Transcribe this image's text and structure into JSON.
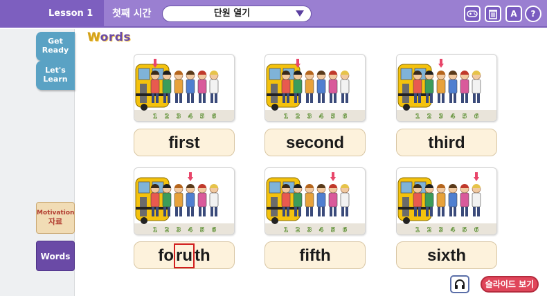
{
  "header": {
    "lesson_label": "Lesson 1",
    "session_title": "첫째 시간",
    "unit_select_value": "단원 열기",
    "tools": [
      {
        "icon": "gamepad-icon"
      },
      {
        "icon": "trash-icon"
      },
      {
        "icon": "dictionary-icon",
        "label": "A"
      },
      {
        "icon": "help-icon",
        "label": "?"
      }
    ]
  },
  "sidebar": {
    "get_ready": [
      "Get",
      "Ready"
    ],
    "lets_learn": [
      "Let's",
      "Learn"
    ],
    "motivation": [
      "Motivation",
      "자료"
    ],
    "words": "Words"
  },
  "main": {
    "heading_first": "W",
    "heading_rest": "ords",
    "cards": [
      {
        "word": "first",
        "arrow_person": 1
      },
      {
        "word": "second",
        "arrow_person": 2
      },
      {
        "word": "third",
        "arrow_person": 3
      },
      {
        "word_pre": "fo",
        "word_box": "ru",
        "word_post": "th",
        "arrow_person": 4
      },
      {
        "word": "fifth",
        "arrow_person": 5
      },
      {
        "word": "sixth",
        "arrow_person": 6
      }
    ],
    "person_numbers": [
      "1",
      "2",
      "3",
      "4",
      "5",
      "6"
    ]
  },
  "footer": {
    "slide_button": "슬라이드 보기"
  },
  "colors": {
    "topbar": "#9a7fd1",
    "accent_purple": "#6a4aa6",
    "word_card": "#fdf2dc",
    "slide_button": "#e0465a",
    "highlight_box": "#d11d1d"
  }
}
